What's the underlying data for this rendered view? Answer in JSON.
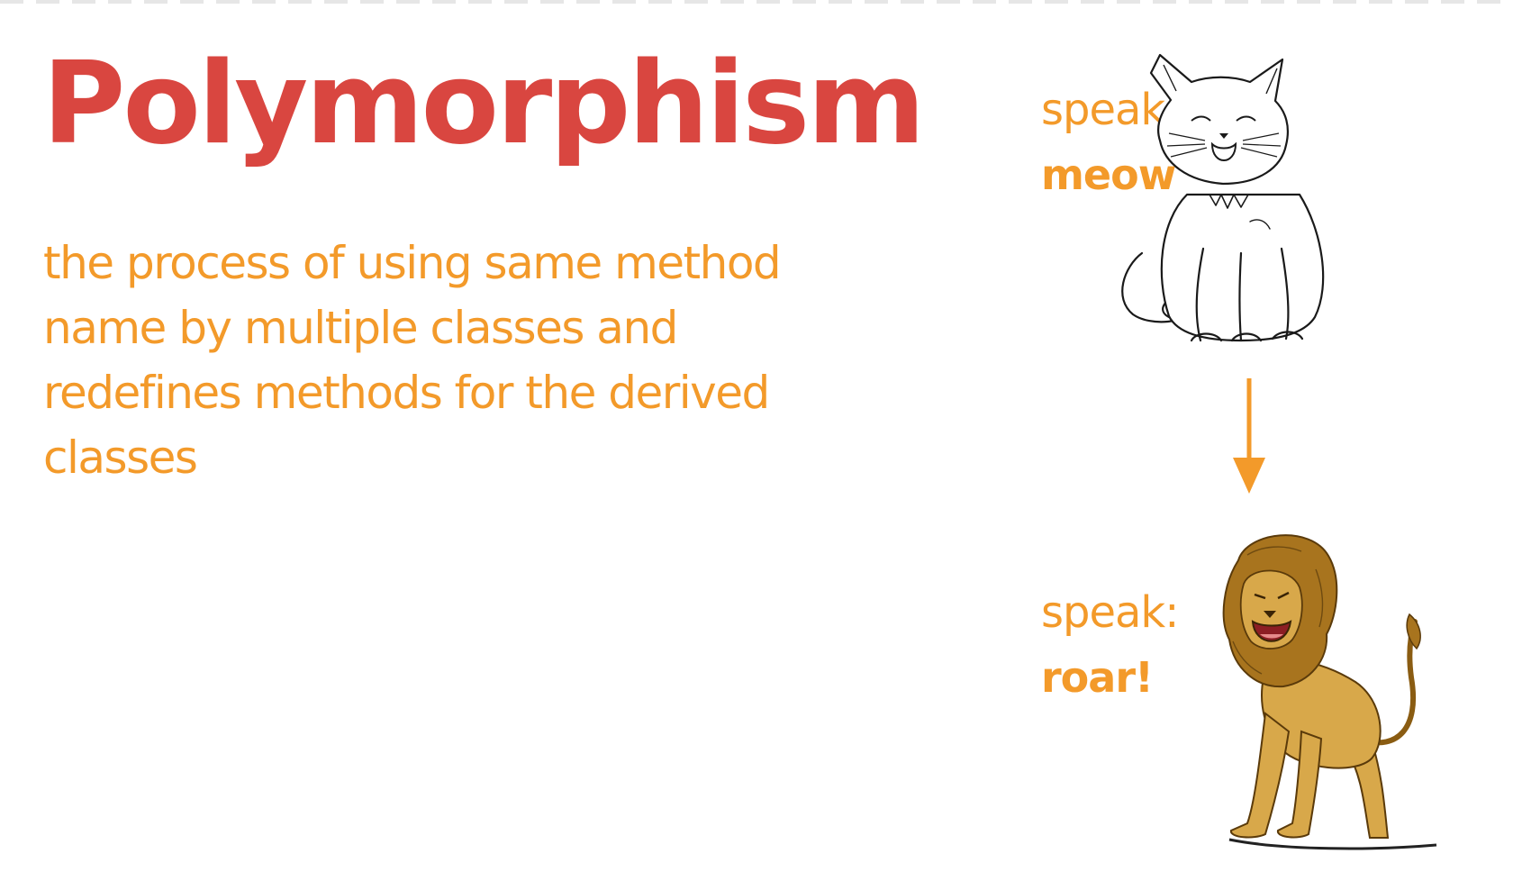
{
  "slide": {
    "title": "Polymorphism",
    "definition": "the process of using same method name by multiple classes and redefines methods for the derived classes"
  },
  "examples": [
    {
      "animal": "cat",
      "speak_label": "speak:",
      "speak_value": "meow"
    },
    {
      "animal": "lion",
      "speak_label": "speak:",
      "speak_value": "roar!"
    }
  ],
  "colors": {
    "title": "#d94640",
    "accent": "#f39a2a",
    "lion_body": "#d8a84a",
    "lion_mane": "#a8741e"
  },
  "icons": [
    "cat-illustration",
    "lion-illustration",
    "arrow-down-icon"
  ]
}
